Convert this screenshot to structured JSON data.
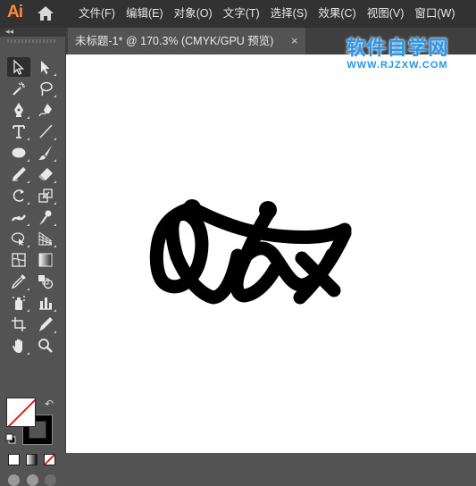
{
  "app": {
    "logo_text": "Ai",
    "home_icon": "home-icon",
    "menus": [
      "文件(F)",
      "编辑(E)",
      "对象(O)",
      "文字(T)",
      "选择(S)",
      "效果(C)",
      "视图(V)",
      "窗口(W)"
    ]
  },
  "document_tab": {
    "title": "未标题-1* @ 170.3% (CMYK/GPU 预览)",
    "close_label": "×"
  },
  "panel": {
    "collapse_label": "◂◂"
  },
  "toolbar": {
    "tools": [
      "selection-tool",
      "direct-selection-tool",
      "magic-wand-tool",
      "lasso-tool",
      "pen-tool",
      "curvature-tool",
      "type-tool",
      "line-segment-tool",
      "ellipse-tool",
      "paintbrush-tool",
      "pencil-tool",
      "eraser-tool",
      "rotate-tool",
      "scale-tool",
      "width-tool",
      "puppet-warp-tool",
      "shape-builder-tool",
      "perspective-grid-tool",
      "mesh-tool",
      "gradient-tool",
      "eyedropper-tool",
      "blend-tool",
      "symbol-sprayer-tool",
      "column-graph-tool",
      "artboard-tool",
      "slice-tool",
      "hand-tool",
      "zoom-tool"
    ],
    "active_tool": "selection-tool",
    "swap_label": "↶",
    "colors": {
      "fill": "none",
      "stroke": "#000000",
      "none_slash": "#e0201a"
    }
  },
  "watermark": {
    "title": "软件自学网",
    "url": "WWW.RJZXW.COM",
    "color": "#2196f3"
  },
  "canvas": {
    "background": "#ffffff",
    "artwork_color": "#000000"
  }
}
